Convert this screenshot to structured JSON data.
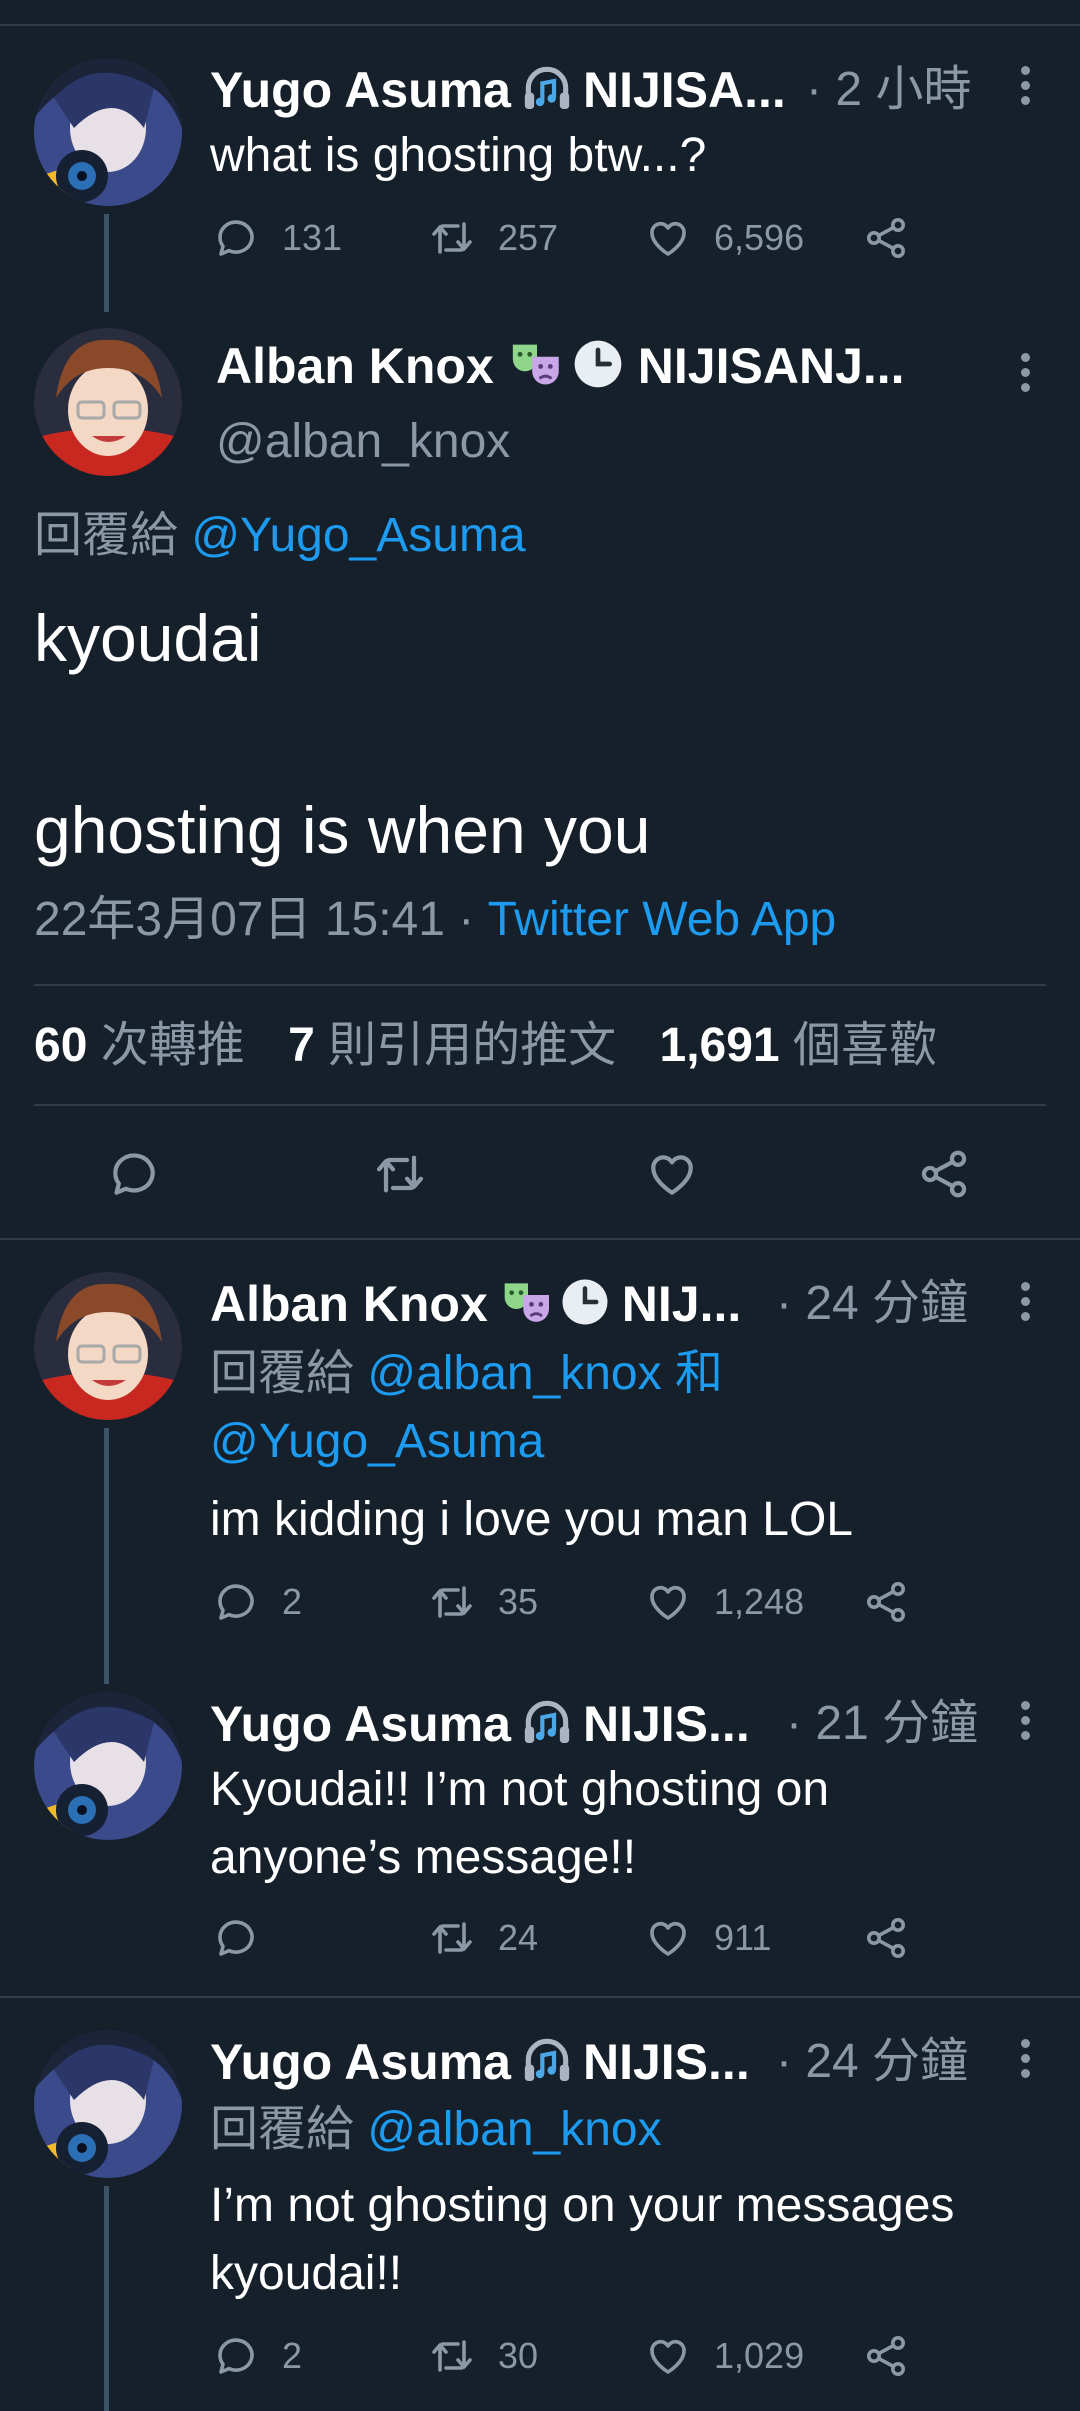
{
  "tweet1": {
    "name": "Yugo Asuma",
    "name_suffix": "NIJISA...",
    "time": "· 2 小時",
    "text": "what is ghosting btw...?",
    "replies": "131",
    "retweets": "257",
    "likes": "6,596"
  },
  "main": {
    "name": "Alban Knox",
    "name_suffix": "NIJISANJ...",
    "handle": "@alban_knox",
    "reply_prefix": "回覆給",
    "reply_to": "@Yugo_Asuma",
    "text_line1": "kyoudai",
    "text_line2": "ghosting is when you",
    "timestamp": "22年3月07日 15:41 ·",
    "source": "Twitter Web App",
    "retweet_count": "60",
    "retweet_label": "次轉推",
    "quote_count": "7",
    "quote_label": "則引用的推文",
    "like_count": "1,691",
    "like_label": "個喜歡"
  },
  "reply1": {
    "name": "Alban Knox",
    "name_suffix": "NIJ...",
    "time": "· 24 分鐘",
    "reply_prefix": "回覆給",
    "reply_to_1": "@alban_knox",
    "conj": "和",
    "reply_to_2": "@Yugo_Asuma",
    "text": "im kidding i love you man LOL",
    "replies": "2",
    "retweets": "35",
    "likes": "1,248"
  },
  "reply2": {
    "name": "Yugo Asuma",
    "name_suffix": "NIJIS...",
    "time": "· 21 分鐘",
    "text_line1": "Kyoudai!! I’m not ghosting on",
    "text_line2": "anyone’s message!!",
    "retweets": "24",
    "likes": "911"
  },
  "reply3": {
    "name": "Yugo Asuma",
    "name_suffix": "NIJIS...",
    "time": "· 24 分鐘",
    "reply_prefix": "回覆給",
    "reply_to": "@alban_knox",
    "text_line1": "I’m not ghosting on your messages",
    "text_line2": "kyoudai!!",
    "replies": "2",
    "retweets": "30",
    "likes": "1,029"
  },
  "colors": {
    "background": "#15202b",
    "text": "#ffffff",
    "muted": "#8b98a5",
    "link": "#1d9bf0",
    "divider": "#2f3b47"
  }
}
